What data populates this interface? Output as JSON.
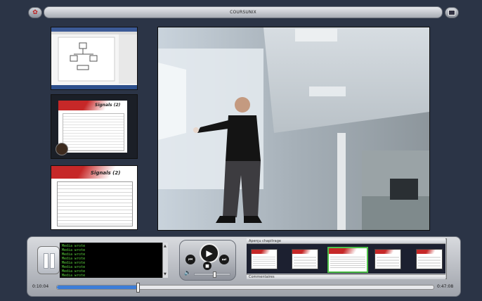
{
  "header": {
    "title": "COURSUNIX"
  },
  "console": {
    "lines": [
      "Media wrote",
      "Media wrote",
      "Media wrote",
      "Media wrote",
      "Media wrote",
      "Media wrote",
      "Media wrote",
      "Media wrote"
    ]
  },
  "panel": {
    "chapters_label": "Aperçu chapitrage",
    "comments_label": "Commentaires"
  },
  "thumbnails": [
    {
      "title": "",
      "kind": "diagram"
    },
    {
      "title": "Signals (2)",
      "kind": "slide"
    },
    {
      "title": "Signals (2)",
      "kind": "slide"
    }
  ],
  "timeline": {
    "current": "0:10:04",
    "total": "0:47:08",
    "progress": 0.214
  },
  "colors": {
    "background": "#2b3446",
    "progress": "#3b7dd8",
    "selected_chapter": "#4fc24a",
    "console_text": "#5bd23c"
  }
}
